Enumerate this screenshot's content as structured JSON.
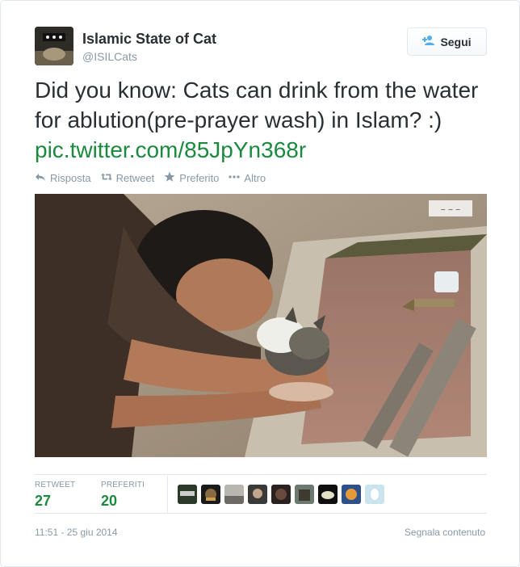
{
  "user": {
    "name": "Islamic State of Cat",
    "handle": "@ISILCats"
  },
  "follow_button": {
    "label": "Segui",
    "icon": "add-user-icon"
  },
  "tweet": {
    "text": "Did you know: Cats can drink from the water for ablution(pre-prayer wash) in Islam? :) ",
    "link": "pic.twitter.com/85JpYn368r"
  },
  "actions": [
    {
      "label": "Risposta",
      "icon": "reply-icon"
    },
    {
      "label": "Retweet",
      "icon": "retweet-icon"
    },
    {
      "label": "Preferito",
      "icon": "star-icon"
    },
    {
      "label": "Altro",
      "icon": "more-icon"
    }
  ],
  "stats": {
    "retweets_label": "RETWEET",
    "retweets_value": "27",
    "favorites_label": "PREFERITI",
    "favorites_value": "20"
  },
  "favorited_by_count": 9,
  "timestamp": "11:51 - 25 giu 2014",
  "report_label": "Segnala contenuto",
  "colors": {
    "link": "#1a8a3e",
    "muted": "#8899a6",
    "border": "#e1e8ed",
    "text": "#292f33"
  }
}
